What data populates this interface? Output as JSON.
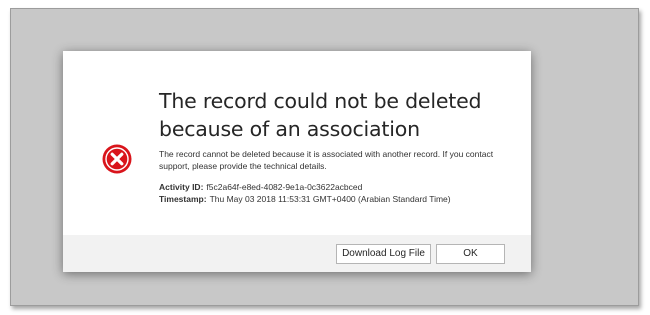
{
  "dialog": {
    "title": "The record could not be deleted because of an association",
    "message": "The record cannot be deleted because it is associated with another record. If you contact support, please provide the technical details.",
    "activity_id_label": "Activity ID:",
    "activity_id_value": "f5c2a64f-e8ed-4082-9e1a-0c3622acbced",
    "timestamp_label": "Timestamp:",
    "timestamp_value": "Thu May 03 2018 11:53:31 GMT+0400 (Arabian Standard Time)",
    "icon": "error-icon",
    "buttons": {
      "download_label": "Download Log File",
      "ok_label": "OK"
    }
  },
  "colors": {
    "error_red": "#d9141b",
    "backdrop": "#c8c8c8",
    "footer": "#f2f2f2"
  }
}
